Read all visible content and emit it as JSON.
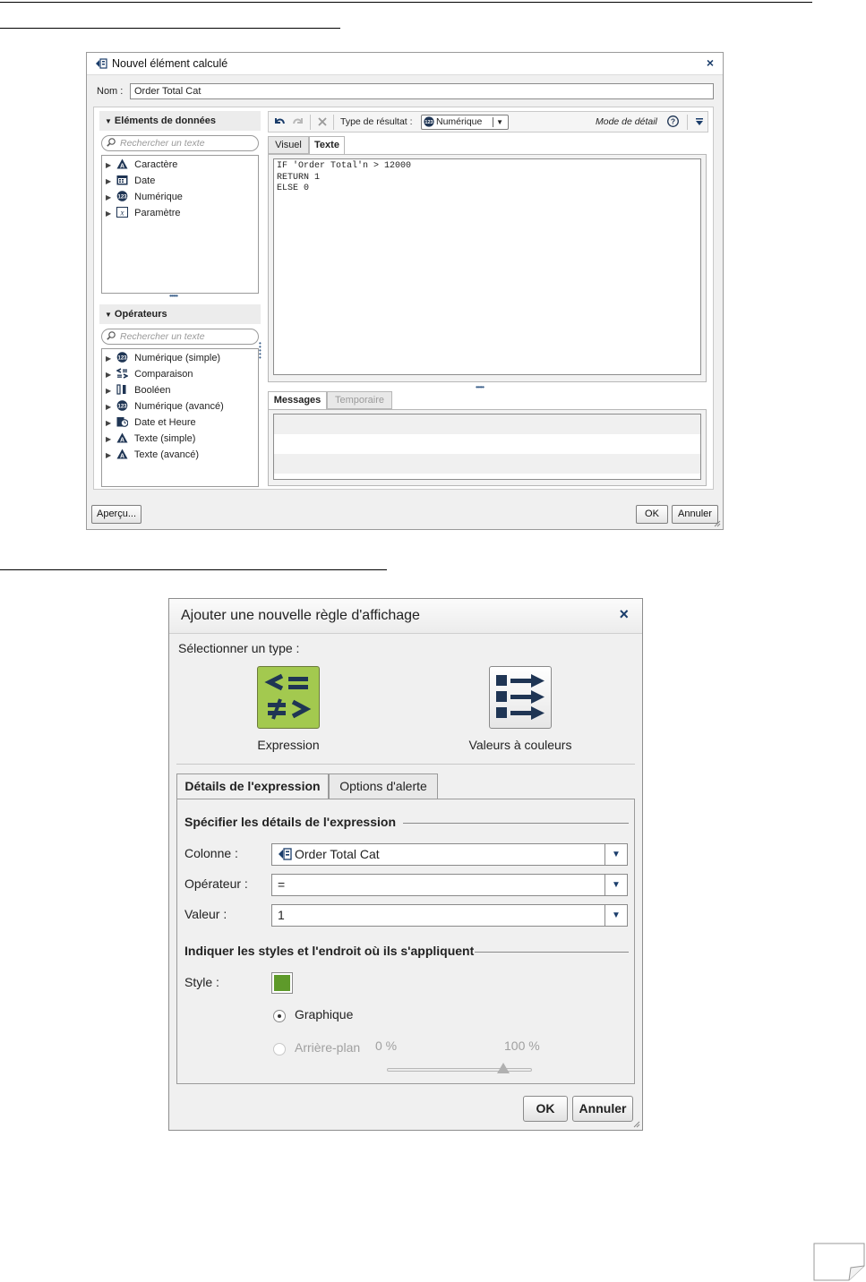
{
  "dialog1": {
    "title": "Nouvel élément calculé",
    "close": "×",
    "name_label": "Nom :",
    "name_value": "Order Total Cat",
    "data_items": {
      "header": "Eléments de données",
      "search_placeholder": "Rechercher un texte",
      "items": [
        "Caractère",
        "Date",
        "Numérique",
        "Paramètre"
      ]
    },
    "operators": {
      "header": "Opérateurs",
      "search_placeholder": "Rechercher un texte",
      "items": [
        "Numérique (simple)",
        "Comparaison",
        "Booléen",
        "Numérique (avancé)",
        "Date et Heure",
        "Texte (simple)",
        "Texte (avancé)"
      ]
    },
    "toolbar": {
      "result_type_label": "Type de résultat :",
      "result_type_value": "Numérique",
      "detail_mode_label": "Mode de détail"
    },
    "tabs": [
      "Visuel",
      "Texte"
    ],
    "active_tab": "Texte",
    "code_lines": [
      "IF 'Order Total'n > 12000",
      "RETURN 1",
      "ELSE 0"
    ],
    "message_tabs": [
      "Messages",
      "Temporaire"
    ],
    "buttons": {
      "preview": "Aperçu...",
      "ok": "OK",
      "cancel": "Annuler"
    }
  },
  "dialog2": {
    "title": "Ajouter une nouvelle règle d'affichage",
    "close": "×",
    "select_type_label": "Sélectionner un type :",
    "types": [
      "Expression",
      "Valeurs à couleurs"
    ],
    "tabs": [
      "Détails de l'expression",
      "Options d'alerte"
    ],
    "active_tab": "Détails de l'expression",
    "expression_group": "Spécifier les détails de l'expression",
    "fields": {
      "column": {
        "label": "Colonne :",
        "value": "Order Total Cat"
      },
      "operator": {
        "label": "Opérateur :",
        "value": "="
      },
      "value": {
        "label": "Valeur :",
        "value": "1"
      }
    },
    "style_group": "Indiquer les styles et l'endroit où ils s'appliquent",
    "style_label": "Style :",
    "style_color": "#5e9a2a",
    "apply_options": [
      "Graphique",
      "Arrière-plan"
    ],
    "selected_option": "Graphique",
    "transparency": {
      "min_label": "0 %",
      "max_label": "100 %",
      "value_fraction": 0.8
    },
    "buttons": {
      "ok": "OK",
      "cancel": "Annuler"
    }
  },
  "colors": {
    "accent": "#1a3d6b",
    "expression_icon_bg": "#a3c94f"
  }
}
